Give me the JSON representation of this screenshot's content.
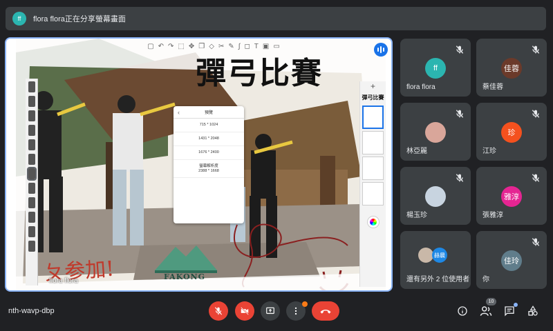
{
  "banner": {
    "avatar_text": "ff",
    "text": "flora flora正在分享螢幕畫面"
  },
  "share": {
    "title": "彈弓比賽",
    "popup": {
      "header": "預覽",
      "options": [
        "715 * 1024",
        "1431 * 2048",
        "1676 * 2400"
      ],
      "best_label": "螢幕解析度",
      "best_value": "2388 * 1668"
    },
    "panel_title": "彈弓比賽",
    "logo_text": "FAKONG",
    "handwriting": "ㄆ参加!",
    "presenter_name": "flora flora"
  },
  "participants": [
    {
      "name": "flora flora",
      "avatar_text": "ff",
      "avatar_color": "#2bb5b0"
    },
    {
      "name": "蔡佳蓉",
      "avatar_text": "佳蓉",
      "avatar_color": "#6b3a2a"
    },
    {
      "name": "林亞麗",
      "avatar_text": "",
      "avatar_color": "#d9a69a"
    },
    {
      "name": "江珍",
      "avatar_text": "珍",
      "avatar_color": "#f4511e"
    },
    {
      "name": "楊玉珍",
      "avatar_text": "",
      "avatar_color": "#c8d4e0"
    },
    {
      "name": "張雅淳",
      "avatar_text": "雅淳",
      "avatar_color": "#e52592"
    },
    {
      "name": "還有另外 2 位使用者",
      "avatar_text": "赫晨",
      "avatar_color": "#1e88e5"
    },
    {
      "name": "你",
      "avatar_text": "佳玲",
      "avatar_color": "#607d8b"
    }
  ],
  "bottom": {
    "meeting_code": "nth-wavp-dbp",
    "people_count": "10"
  }
}
